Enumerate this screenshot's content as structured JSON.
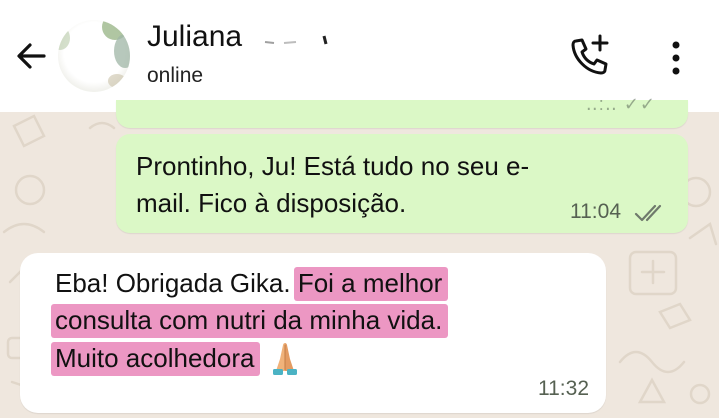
{
  "header": {
    "name": "Juliana",
    "status": "online",
    "icons": {
      "back": "back-arrow-icon",
      "avatar": "avatar",
      "call": "add-call-icon",
      "menu": "more-vertical-icon"
    }
  },
  "messages": [
    {
      "direction": "outgoing",
      "text": "Prontinho, Ju! Está tudo no seu e-mail. Fico à disposição.",
      "time": "11:04",
      "status": "read"
    },
    {
      "direction": "incoming",
      "text_plain": "Eba! Obrigada Gika.",
      "text_highlighted": [
        "Foi a melhor",
        "consulta com nutri da minha vida.",
        "Muito acolhedora"
      ],
      "emoji": "folded-hands-icon",
      "time": "11:32"
    }
  ],
  "colors": {
    "header_bg": "#ffffff",
    "wallpaper": "#efe7de",
    "outgoing_bubble": "#dbf8c6",
    "incoming_bubble": "#ffffff",
    "highlight": "#df4c98",
    "read_ticks": "#6f7a6c"
  }
}
